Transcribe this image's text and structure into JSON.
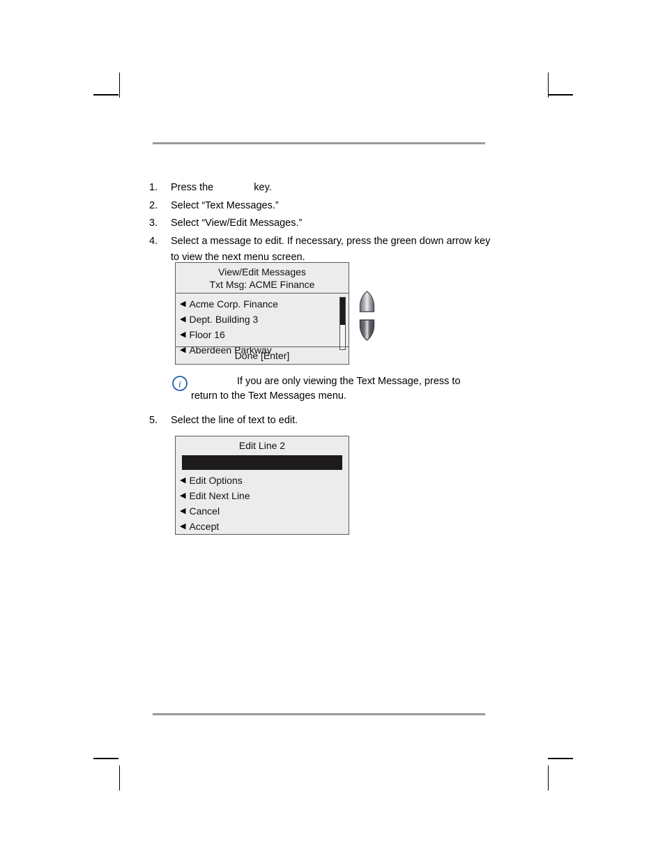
{
  "document": {
    "steps": [
      {
        "num": "1.",
        "text_before": "Press the",
        "inline_icon": "menu-key-icon",
        "text_after": "key."
      },
      {
        "num": "2.",
        "text_before": "Select “Text Messages.”",
        "inline_icon": "",
        "text_after": ""
      },
      {
        "num": "3.",
        "text_before": "Select “View/Edit Messages.”",
        "inline_icon": "",
        "text_after": ""
      },
      {
        "num": "4.",
        "text_before": "Select a message to edit. If necessary, press the green down arrow key to view the next menu screen.",
        "inline_icon": "",
        "text_after": ""
      }
    ],
    "step5": {
      "num": "5.",
      "text": "Select the line of text to edit."
    },
    "note": {
      "icon": "info-icon",
      "icon_color": "#1f5fad",
      "text_before": "If you are only viewing the Text Message, press",
      "text_after": "to return to the Text Messages menu."
    }
  },
  "screen1": {
    "title_line1": "View/Edit Messages",
    "title_line2": "Txt Msg:  ACME Finance",
    "items": [
      "Acme Corp. Finance",
      "Dept. Building 3",
      "Floor 16",
      "Aberdeen Parkway"
    ],
    "footer": "Done [Enter]",
    "scrollbar": {
      "thumb_percent": 53
    },
    "bullet_glyph": "◀"
  },
  "screen2": {
    "title": "Edit Line 2",
    "highlight_row": "",
    "items": [
      "Edit Options",
      "Edit Next Line",
      "Cancel",
      "Accept"
    ],
    "bullet_glyph": "◀"
  },
  "keys": {
    "up": "up-arrow-key",
    "down": "down-arrow-key"
  },
  "colors": {
    "lcd_background": "#ececec",
    "lcd_border": "#5a5a5a",
    "rule": "#999999",
    "highlight": "#1c1a1a",
    "info_blue": "#1f5fad"
  }
}
